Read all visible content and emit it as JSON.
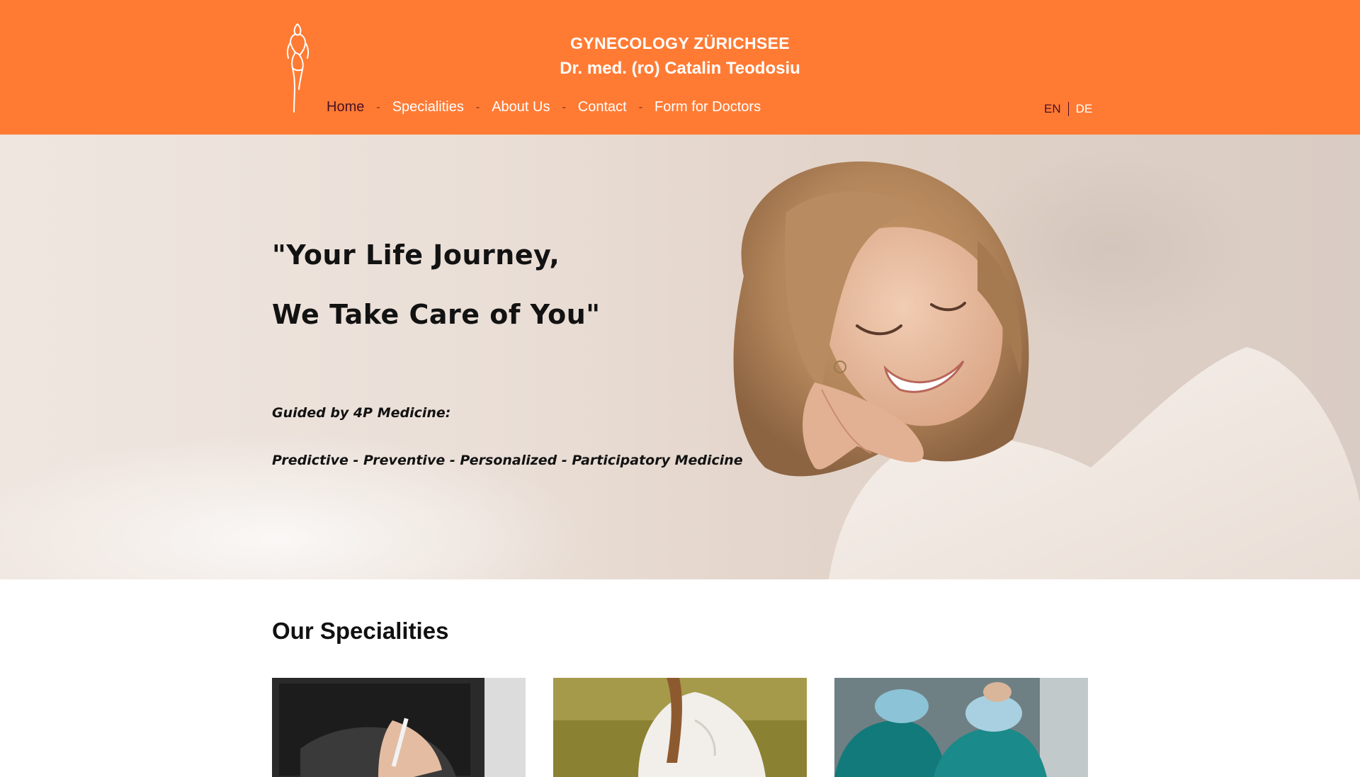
{
  "header": {
    "title_line1": "GYNECOLOGY ZÜRICHSEE",
    "title_line2": "Dr. med. (ro) Catalin Teodosiu",
    "logo_icon": "female-figure-logo-icon",
    "nav": [
      {
        "label": "Home",
        "active": true
      },
      {
        "label": "Specialities",
        "active": false
      },
      {
        "label": "About Us",
        "active": false
      },
      {
        "label": "Contact",
        "active": false
      },
      {
        "label": "Form for Doctors",
        "active": false
      }
    ],
    "nav_separator": "-",
    "languages": {
      "en": "EN",
      "de": "DE",
      "active": "EN"
    }
  },
  "hero": {
    "quote_line1": "\"Your Life Journey,",
    "quote_line2": "We Take Care of You\"",
    "subtitle_line1": "Guided by 4P Medicine:",
    "subtitle_line2": "Predictive - Preventive - Personalized - Participatory Medicine"
  },
  "specialities": {
    "title": "Our Specialities"
  },
  "colors": {
    "header_bg": "#ff7b34",
    "active_nav": "#4a1024",
    "text_dark": "#121212"
  }
}
